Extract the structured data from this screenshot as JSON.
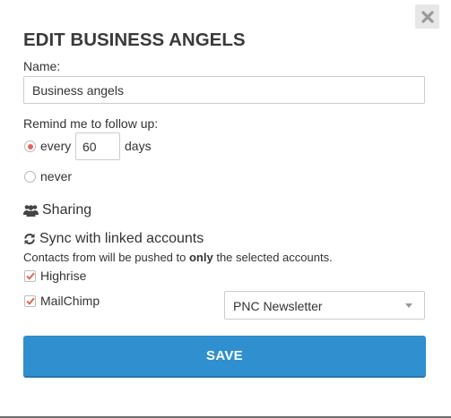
{
  "dialog": {
    "title": "EDIT BUSINESS ANGELS",
    "close_icon": "close-x-icon"
  },
  "name_field": {
    "label": "Name:",
    "value": "Business angels"
  },
  "reminder": {
    "label": "Remind me to follow up:",
    "options": [
      {
        "label": "every",
        "selected": true
      },
      {
        "label": "never",
        "selected": false
      }
    ],
    "days_value": "60",
    "days_unit": "days"
  },
  "sharing": {
    "icon": "users-icon",
    "label": "Sharing"
  },
  "sync": {
    "icon": "refresh-icon",
    "label": "Sync with linked accounts",
    "note_prefix": "Contacts from will be pushed to ",
    "note_emphasis": "only",
    "note_suffix": " the selected accounts.",
    "accounts": [
      {
        "label": "Highrise",
        "checked": true
      },
      {
        "label": "MailChimp",
        "checked": true
      }
    ],
    "mailchimp_list_selected": "PNC Newsletter"
  },
  "actions": {
    "save_label": "SAVE"
  },
  "colors": {
    "accent_red": "#e3675a",
    "save_blue": "#2f8fcf"
  }
}
